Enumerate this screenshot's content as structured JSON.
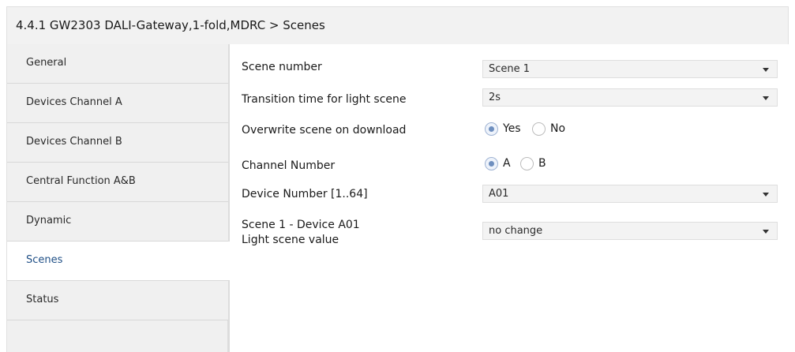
{
  "header": {
    "title": "4.4.1 GW2303 DALI-Gateway,1-fold,MDRC > Scenes"
  },
  "sidebar": {
    "items": [
      {
        "label": "General"
      },
      {
        "label": "Devices Channel A"
      },
      {
        "label": "Devices Channel B"
      },
      {
        "label": "Central Function A&B"
      },
      {
        "label": "Dynamic"
      },
      {
        "label": "Scenes"
      },
      {
        "label": "Status"
      }
    ],
    "active": "Scenes"
  },
  "params": {
    "scene_number": {
      "label": "Scene number",
      "value": "Scene 1"
    },
    "transition_time": {
      "label": "Transition time for light scene",
      "value": "2s"
    },
    "overwrite_scene": {
      "label": "Overwrite scene on download",
      "options": [
        "Yes",
        "No"
      ],
      "selected": "Yes"
    },
    "channel_number": {
      "label": "Channel Number",
      "options": [
        "A",
        "B"
      ],
      "selected": "A"
    },
    "device_number": {
      "label": "Device Number [1..64]",
      "value": "A01"
    },
    "light_scene": {
      "label_line1": "Scene 1 - Device A01",
      "label_line2": "Light scene value",
      "value": "no change"
    }
  },
  "colors": {
    "active_nav_text": "#1f4f86",
    "radio_checked": "#6e8fbf"
  },
  "icons": {
    "dropdown": "caret-down-icon",
    "radio": "radio-icon"
  }
}
